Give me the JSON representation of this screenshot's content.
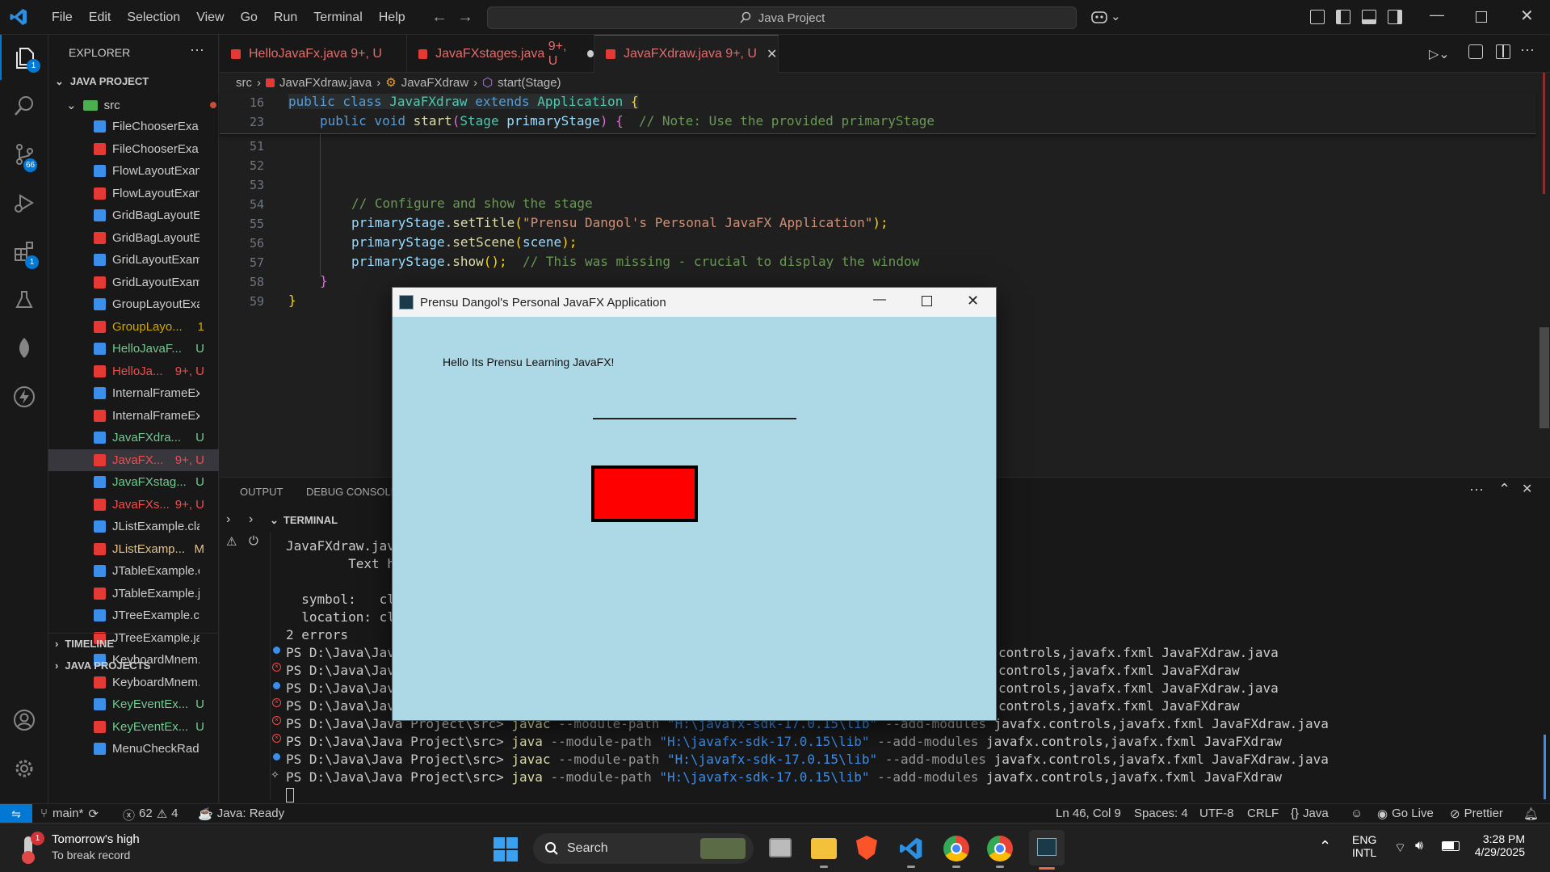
{
  "titlebar": {
    "menu": [
      "File",
      "Edit",
      "Selection",
      "View",
      "Go",
      "Run",
      "Terminal",
      "Help"
    ],
    "search": "Java Project"
  },
  "activity": {
    "explorer_badge": "1",
    "scm_badge": "66",
    "extensions_badge": "1"
  },
  "sidebar": {
    "header": "EXPLORER",
    "project": "JAVA PROJECT",
    "src": "src",
    "files": [
      {
        "name": "FileChooserExa...",
        "status": "",
        "color": "#3b8eea",
        "text": "#cccccc"
      },
      {
        "name": "FileChooserExa...",
        "status": "",
        "color": "#e53935",
        "text": "#cccccc"
      },
      {
        "name": "FlowLayoutExam...",
        "status": "",
        "color": "#3b8eea",
        "text": "#cccccc"
      },
      {
        "name": "FlowLayoutExam...",
        "status": "",
        "color": "#e53935",
        "text": "#cccccc"
      },
      {
        "name": "GridBagLayoutE...",
        "status": "",
        "color": "#3b8eea",
        "text": "#cccccc"
      },
      {
        "name": "GridBagLayoutE...",
        "status": "",
        "color": "#e53935",
        "text": "#cccccc"
      },
      {
        "name": "GridLayoutExam...",
        "status": "",
        "color": "#3b8eea",
        "text": "#cccccc"
      },
      {
        "name": "GridLayoutExam...",
        "status": "",
        "color": "#e53935",
        "text": "#cccccc"
      },
      {
        "name": "GroupLayoutExa...",
        "status": "",
        "color": "#3b8eea",
        "text": "#cccccc"
      },
      {
        "name": "GroupLayo...",
        "status": "1",
        "color": "#e53935",
        "text": "#cca700"
      },
      {
        "name": "HelloJavaF...",
        "status": "U",
        "color": "#3b8eea",
        "text": "#73c991"
      },
      {
        "name": "HelloJa...",
        "status": "9+, U",
        "color": "#e53935",
        "text": "#f14c4c"
      },
      {
        "name": "InternalFrameEx...",
        "status": "",
        "color": "#3b8eea",
        "text": "#cccccc"
      },
      {
        "name": "InternalFrameEx...",
        "status": "",
        "color": "#e53935",
        "text": "#cccccc"
      },
      {
        "name": "JavaFXdra...",
        "status": "U",
        "color": "#3b8eea",
        "text": "#73c991"
      },
      {
        "name": "JavaFX...",
        "status": "9+, U",
        "color": "#e53935",
        "text": "#f14c4c"
      },
      {
        "name": "JavaFXstag...",
        "status": "U",
        "color": "#3b8eea",
        "text": "#73c991"
      },
      {
        "name": "JavaFXs...",
        "status": "9+, U",
        "color": "#e53935",
        "text": "#f14c4c"
      },
      {
        "name": "JListExample.class",
        "status": "",
        "color": "#3b8eea",
        "text": "#cccccc"
      },
      {
        "name": "JListExamp...",
        "status": "M",
        "color": "#e53935",
        "text": "#e2c08d"
      },
      {
        "name": "JTableExample.cl...",
        "status": "",
        "color": "#3b8eea",
        "text": "#cccccc"
      },
      {
        "name": "JTableExample.ja...",
        "status": "",
        "color": "#e53935",
        "text": "#cccccc"
      },
      {
        "name": "JTreeExample.cla...",
        "status": "",
        "color": "#3b8eea",
        "text": "#cccccc"
      },
      {
        "name": "JTreeExample.java",
        "status": "",
        "color": "#e53935",
        "text": "#cccccc"
      },
      {
        "name": "KeyboardMnem...",
        "status": "",
        "color": "#3b8eea",
        "text": "#cccccc"
      },
      {
        "name": "KeyboardMnem...",
        "status": "",
        "color": "#e53935",
        "text": "#cccccc"
      },
      {
        "name": "KeyEventEx...",
        "status": "U",
        "color": "#3b8eea",
        "text": "#73c991"
      },
      {
        "name": "KeyEventEx...",
        "status": "U",
        "color": "#e53935",
        "text": "#73c991"
      },
      {
        "name": "MenuCheckRadi...",
        "status": "",
        "color": "#3b8eea",
        "text": "#cccccc"
      }
    ],
    "timeline": "TIMELINE",
    "java_projects": "JAVA PROJECTS"
  },
  "tabs": [
    {
      "label": "HelloJavaFx.java",
      "status": "9+, U"
    },
    {
      "label": "JavaFXstages.java",
      "status": "9+, U"
    },
    {
      "label": "JavaFXdraw.java",
      "status": "9+, U"
    }
  ],
  "breadcrumb": {
    "a": "src",
    "b": "JavaFXdraw.java",
    "c": "JavaFXdraw",
    "d": "start(Stage)"
  },
  "code": {
    "line_numbers": [
      "16",
      "23",
      "51",
      "52",
      "53",
      "54",
      "55",
      "56",
      "57",
      "58",
      "59"
    ],
    "l16": {
      "kw1": "public class ",
      "cls": "JavaFXdraw",
      "kw2": " extends ",
      "base": "Application",
      "brace": " {"
    },
    "l23": {
      "kw": "public void ",
      "fn": "start",
      "op": "(",
      "ty": "Stage",
      "pa": " primaryStage",
      "cl": ") {",
      "cm": "  // Note: Use the provided primaryStage"
    },
    "l54": "// Configure and show the stage",
    "l55": {
      "obj": "primaryStage",
      "dot": ".",
      "fn": "setTitle",
      "op": "(",
      "str": "\"Prensu Dangol's Personal JavaFX Application\"",
      "end": ");"
    },
    "l56": {
      "obj": "primaryStage",
      "dot": ".",
      "fn": "setScene",
      "op": "(",
      "arg": "scene",
      "end": ");"
    },
    "l57": {
      "obj": "primaryStage",
      "dot": ".",
      "fn": "show",
      "end": "();",
      "cm": "  // This was missing - crucial to display the window"
    },
    "l58": "}",
    "l59": "}"
  },
  "panel": {
    "tabs": [
      "OUTPUT",
      "DEBUG CONSOLE"
    ],
    "terminal_label": "TERMINAL",
    "lines": [
      "JavaFXdraw.java",
      "        Text he",
      "",
      "  symbol:   cla",
      "  location: cla",
      "2 errors"
    ],
    "prompt": "PS D:\\Java\\Java",
    "right_lines": [
      "controls,javafx.fxml JavaFXdraw.java",
      "controls,javafx.fxml JavaFXdraw",
      "controls,javafx.fxml JavaFXdraw.java",
      "controls,javafx.fxml JavaFXdraw"
    ],
    "full_prompt": "PS D:\\Java\\Java Project\\src> ",
    "full_prompt_partial": " Project\\src> ",
    "cmd_javac": "javac",
    "cmd_java": "java",
    "module_flag": " --module-path ",
    "module_path": "\"H:\\javafx-sdk-17.0.15\\lib\"",
    "add_modules": " --add-modules ",
    "modules": "javafx.controls,javafx.fxml",
    "target_java": " JavaFXdraw.java",
    "target_class": " JavaFXdraw"
  },
  "fxwindow": {
    "title": "Prensu Dangol's Personal JavaFX Application",
    "text": "Hello Its Prensu Learning JavaFX!",
    "bg": "#add8e6",
    "rect_color": "#ff0000"
  },
  "status": {
    "branch": "main*",
    "errors": "62",
    "warnings": "4",
    "java": "Java: Ready",
    "position": "Ln 46, Col 9",
    "spaces": "Spaces: 4",
    "encoding": "UTF-8",
    "eol": "CRLF",
    "lang": "Java",
    "golive": "Go Live",
    "prettier": "Prettier"
  },
  "taskbar": {
    "weather_title": "Tomorrow's high",
    "weather_sub": "To break record",
    "weather_badge": "1",
    "search": "Search",
    "lang1": "ENG",
    "lang2": "INTL",
    "time": "3:28 PM",
    "date": "4/29/2025"
  }
}
